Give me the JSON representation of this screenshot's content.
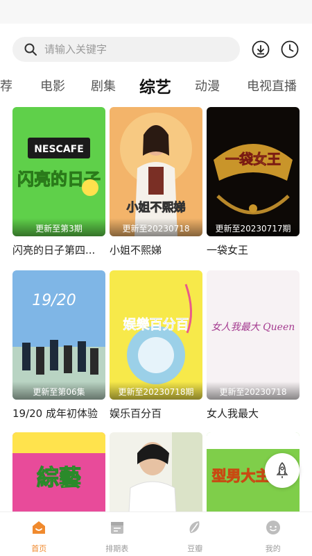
{
  "search": {
    "placeholder": "请输入关键字"
  },
  "tabs": [
    {
      "label": "荐"
    },
    {
      "label": "电影"
    },
    {
      "label": "剧集"
    },
    {
      "label": "综艺"
    },
    {
      "label": "动漫"
    },
    {
      "label": "电视直播"
    }
  ],
  "active_tab": "综艺",
  "cards": [
    {
      "title": "闪亮的日子第四...",
      "update": "更新至第3期",
      "poster_text": "闪亮的日子",
      "brand": "NESCAFE"
    },
    {
      "title": "小姐不熙娣",
      "update": "更新至20230718",
      "poster_text": "小姐不熙娣"
    },
    {
      "title": "一袋女王",
      "update": "更新至20230717期",
      "poster_text": "一袋女王"
    },
    {
      "title": "19/20 成年初体验",
      "update": "更新至第06集",
      "poster_text": "19/20"
    },
    {
      "title": "娱乐百分百",
      "update": "更新至20230718期",
      "poster_text": "娱樂百分百"
    },
    {
      "title": "女人我最大",
      "update": "更新至20230718",
      "poster_text": "女人我最大 Queen"
    },
    {
      "title": "",
      "update": "",
      "poster_text": "綜藝"
    },
    {
      "title": "",
      "update": "",
      "poster_text": ""
    },
    {
      "title": "",
      "update": "",
      "poster_text": "型男大主廚"
    }
  ],
  "bottom_nav": [
    {
      "label": "首页",
      "icon": "home-icon",
      "active": true
    },
    {
      "label": "排期表",
      "icon": "calendar-icon",
      "active": false
    },
    {
      "label": "豆瓣",
      "icon": "douban-icon",
      "active": false
    },
    {
      "label": "我的",
      "icon": "profile-icon",
      "active": false
    }
  ],
  "colors": {
    "accent": "#f08a2e",
    "inactive": "#9b9b9b"
  }
}
